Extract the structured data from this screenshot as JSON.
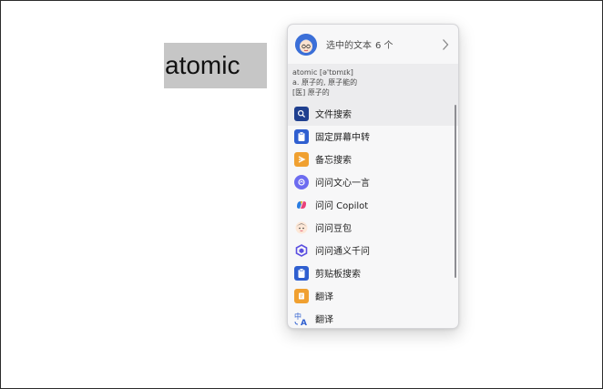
{
  "selection": {
    "text": "atomic"
  },
  "popup": {
    "header": {
      "title": "选中的文本",
      "count": "6 个"
    },
    "dictionary": {
      "headword": "atomic [ə'tɒmɪk]",
      "lines": [
        "a. 原子的, 原子能的",
        "[医] 原子的"
      ]
    },
    "menu": [
      {
        "label": "文件搜索",
        "icon": "search-icon"
      },
      {
        "label": "固定屏幕中转",
        "icon": "pin-clipboard-icon"
      },
      {
        "label": "备忘搜索",
        "icon": "memo-icon"
      },
      {
        "label": "问问文心一言",
        "icon": "wenxin-icon"
      },
      {
        "label": "问问 Copilot",
        "icon": "copilot-icon"
      },
      {
        "label": "问问豆包",
        "icon": "doubao-icon"
      },
      {
        "label": "问问通义千问",
        "icon": "tongyi-icon"
      },
      {
        "label": "剪贴板搜索",
        "icon": "clipboard-icon"
      },
      {
        "label": "翻译",
        "icon": "translate-doc-icon"
      },
      {
        "label": "翻译",
        "icon": "translate-lang-icon"
      }
    ]
  },
  "colors": {
    "accent_blue": "#2f5fd0",
    "orange": "#f0a030",
    "purple": "#6d6cf0",
    "selection_bg": "#c6c6c6"
  }
}
